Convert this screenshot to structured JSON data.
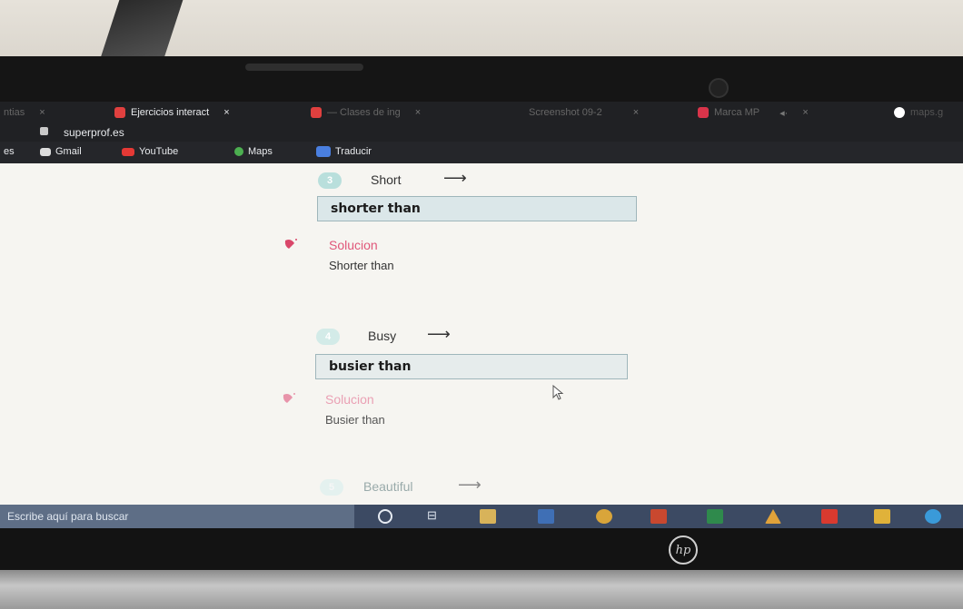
{
  "browser": {
    "tabs": [
      {
        "label": "ntias"
      },
      {
        "label": "Ejercicios interact"
      },
      {
        "label": "— Clases de ing"
      },
      {
        "label": "Screenshot 09-2"
      },
      {
        "label": "Marca MP"
      },
      {
        "label": "maps.g"
      }
    ],
    "url": "superprof.es",
    "bookmarks": [
      "es",
      "Gmail",
      "YouTube",
      "Maps",
      "Traducir"
    ]
  },
  "exercises": [
    {
      "number": "3",
      "word": "Short",
      "answer": "shorter than",
      "solution_label": "Solucion",
      "solution": "Shorter than"
    },
    {
      "number": "4",
      "word": "Busy",
      "answer": "busier than",
      "solution_label": "Solucion",
      "solution": "Busier than"
    },
    {
      "number": "5",
      "word": "Beautiful"
    }
  ],
  "arrow": "⟶",
  "taskbar": {
    "search_placeholder": "Escribe aquí para buscar"
  },
  "brand": "hp",
  "colors": {
    "accent": "#e0577a",
    "badge": "#b9dfdc",
    "answer_bg": "#dbe7e9"
  }
}
